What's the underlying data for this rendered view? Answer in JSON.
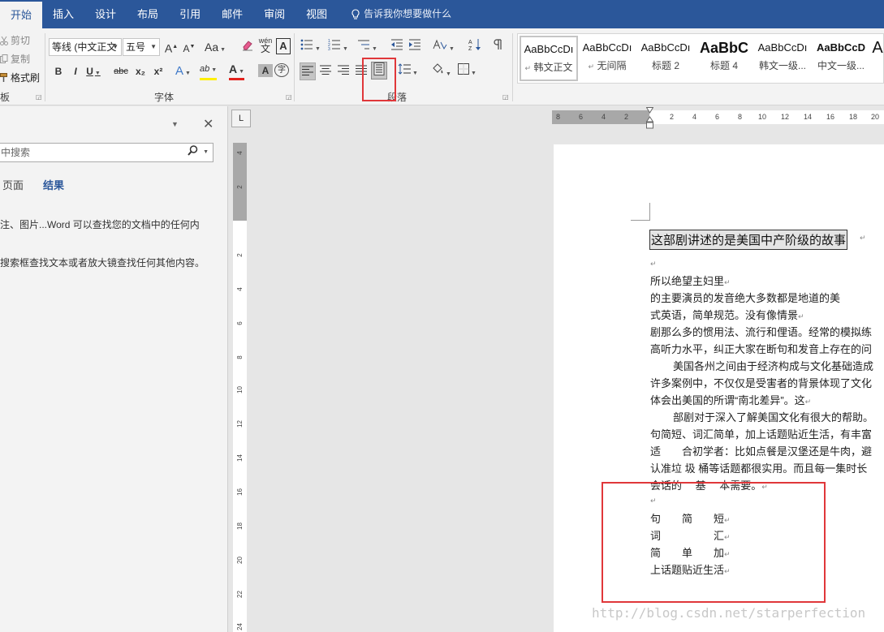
{
  "tabs": [
    "开始",
    "插入",
    "设计",
    "布局",
    "引用",
    "邮件",
    "审阅",
    "视图"
  ],
  "tell_me": "告诉我你想要做什么",
  "clipboard": {
    "cut": "剪切",
    "copy": "复制",
    "format_painter": "格式刷",
    "group_label": "板"
  },
  "font": {
    "font_name": "等线 (中文正文",
    "font_size": "五号",
    "grow": "A",
    "shrink": "A",
    "change_case": "Aa",
    "phonetic": "wén",
    "border_char": "A",
    "bold": "B",
    "italic": "I",
    "underline": "U",
    "strike": "abc",
    "subscript": "x₂",
    "superscript": "x²",
    "effects": "A",
    "highlight": "ab",
    "font_color": "A",
    "shade_char": "A",
    "enclose": "字",
    "group_label": "字体"
  },
  "paragraph": {
    "group_label": "段落"
  },
  "styles": [
    {
      "sample": "AaBbCcDı",
      "name": "韩文正文",
      "mark": "↵"
    },
    {
      "sample": "AaBbCcDı",
      "name": "无间隔",
      "mark": "↵"
    },
    {
      "sample": "AaBbCcDı",
      "name": "标题 2",
      "mark": ""
    },
    {
      "sample": "AaBbC",
      "name": "标题 4",
      "mark": ""
    },
    {
      "sample": "AaBbCcDı",
      "name": "韩文一级...",
      "mark": ""
    },
    {
      "sample": "AaBbCcD",
      "name": "中文一级...",
      "mark": ""
    },
    {
      "sample": "A",
      "name": "",
      "mark": ""
    }
  ],
  "nav_pane": {
    "search_placeholder": "中搜索",
    "tab_pages": "页面",
    "tab_results": "结果",
    "info_line1": "注、图片...Word 可以查找您的文档中的任何内",
    "info_line2": "搜索框查找文本或者放大镜查找任何其他内容。"
  },
  "ruler": {
    "corner": "L",
    "h_numbers": [
      "8",
      "6",
      "4",
      "2",
      "2",
      "4",
      "6",
      "8",
      "10",
      "12",
      "14",
      "16",
      "18",
      "20"
    ],
    "v_numbers": [
      "4",
      "2",
      "2",
      "2",
      "4",
      "6",
      "8",
      "10",
      "12",
      "14",
      "16",
      "18",
      "20",
      "22",
      "24"
    ]
  },
  "document": {
    "title": "这部剧讲述的是美国中产阶级的故事",
    "lines": [
      "所以绝望主妇里",
      "的主要演员的发音绝大多数都是地道的美",
      "式英语，简单规范。没有像情景",
      "剧那么多的惯用法、流行和俚语。经常的模拟练",
      "高听力水平，纠正大家在断句和发音上存在的问",
      "美国各州之间由于经济构成与文化基础造成",
      "许多案例中，不仅仅是受害者的背景体现了文化",
      "体会出美国的所谓“南北差异”。这",
      "部剧对于深入了解美国文化有很大的帮助。",
      "句简短、词汇简单，加上话题贴近生活，有丰富",
      "适　　合初学者：比如点餐是汉堡还是牛肉，避",
      "认准垃 圾 桶等话题都很实用。而且每一集时长",
      "会话的　 基　 本需要。",
      "句　　简　　短",
      "词　　　　　汇",
      "简　　单　　加",
      "上话题贴近生活"
    ]
  },
  "watermark": "http://blog.csdn.net/starperfection"
}
